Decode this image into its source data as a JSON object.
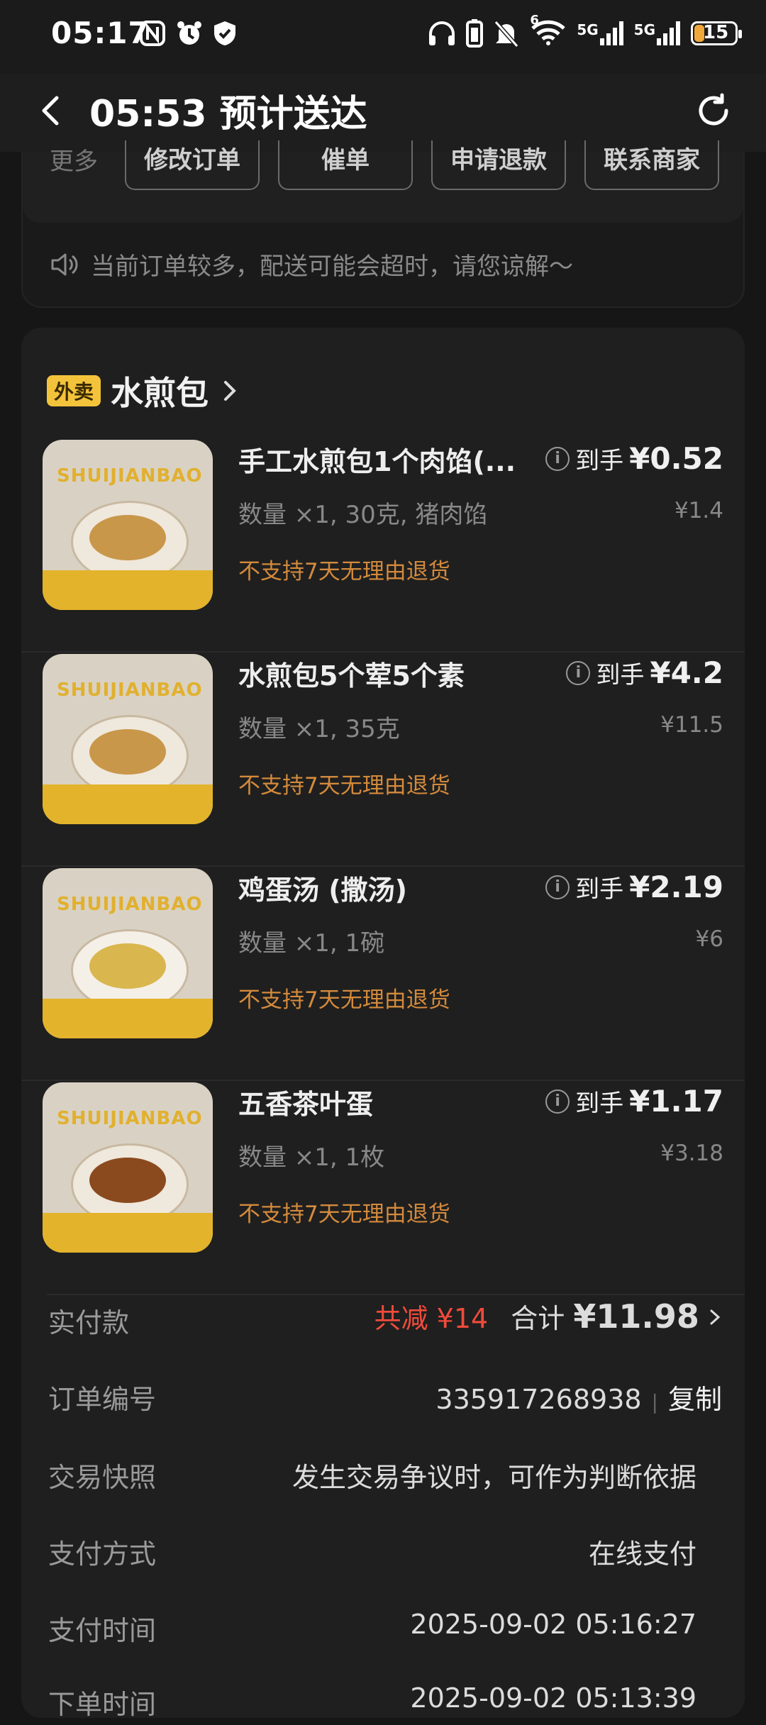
{
  "status_bar": {
    "time": "05:17",
    "battery": "15",
    "net1": "5G",
    "net2": "5G",
    "wifi_badge": "6"
  },
  "header": {
    "title": "05:53 预计送达"
  },
  "actions": {
    "more_label": "更多",
    "buttons": [
      "修改订单",
      "催单",
      "申请退款",
      "联系商家"
    ]
  },
  "notice": {
    "text": "当前订单较多，配送可能会超时，请您谅解～"
  },
  "store": {
    "tag": "外卖",
    "name": "水煎包"
  },
  "items": [
    {
      "name": "手工水煎包1个肉馅(...",
      "spec": "数量 ×1, 30克, 猪肉馅",
      "policy": "不支持7天无理由退货",
      "price_label": "到手",
      "price": "¥0.52",
      "original_price": "¥1.4",
      "thumb_brand": "SHUIJIANBAO",
      "food_color": "#c9974a"
    },
    {
      "name": "水煎包5个荤5个素",
      "spec": "数量 ×1, 35克",
      "policy": "不支持7天无理由退货",
      "price_label": "到手",
      "price": "¥4.2",
      "original_price": "¥11.5",
      "thumb_brand": "SHUIJIANBAO",
      "food_color": "#c9974a"
    },
    {
      "name": "鸡蛋汤 (撒汤)",
      "spec": "数量 ×1, 1碗",
      "policy": "不支持7天无理由退货",
      "price_label": "到手",
      "price": "¥2.19",
      "original_price": "¥6",
      "thumb_brand": "SHUIJIANBAO",
      "food_color": "#d9b64e"
    },
    {
      "name": "五香茶叶蛋",
      "spec": "数量 ×1, 1枚",
      "policy": "不支持7天无理由退货",
      "price_label": "到手",
      "price": "¥1.17",
      "original_price": "¥3.18",
      "thumb_brand": "SHUIJIANBAO",
      "food_color": "#8a4a1e"
    }
  ],
  "summary": {
    "paid_label": "实付款",
    "discount": "共减 ¥14",
    "total_label": "合计",
    "total": "¥11.98",
    "order_no_label": "订单编号",
    "order_no": "335917268938",
    "copy": "复制",
    "snapshot_label": "交易快照",
    "snapshot_value": "发生交易争议时，可作为判断依据",
    "pay_method_label": "支付方式",
    "pay_method": "在线支付",
    "pay_time_label": "支付时间",
    "pay_time": "2025-09-02 05:16:27",
    "order_time_label": "下单时间",
    "order_time": "2025-09-02 05:13:39"
  }
}
